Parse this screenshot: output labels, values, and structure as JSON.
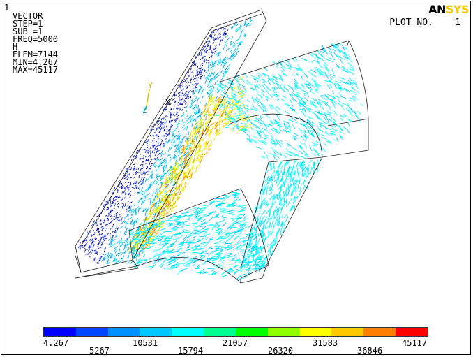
{
  "window_number": "1",
  "plot_info": [
    "VECTOR",
    "STEP=1",
    "SUB =1",
    "FREQ=5000",
    "H",
    "ELEM=7144",
    "MIN=4.267",
    "MAX=45117"
  ],
  "logo": {
    "part1": "AN",
    "part2": "SYS"
  },
  "plot_no_label": "PLOT NO.    1",
  "triad": {
    "x": "X",
    "y": "Y",
    "z": "Z"
  },
  "legend": {
    "colors": [
      "#0000ff",
      "#0045ff",
      "#0090ff",
      "#00c8ff",
      "#00ffff",
      "#00ff90",
      "#00ff00",
      "#90ff00",
      "#ffff00",
      "#ffc800",
      "#ff7f00",
      "#ff0000"
    ],
    "row1": [
      "4.267",
      "10531",
      "21057",
      "31583",
      "45117"
    ],
    "row2": [
      "5267",
      "15794",
      "26320",
      "36846"
    ]
  }
}
